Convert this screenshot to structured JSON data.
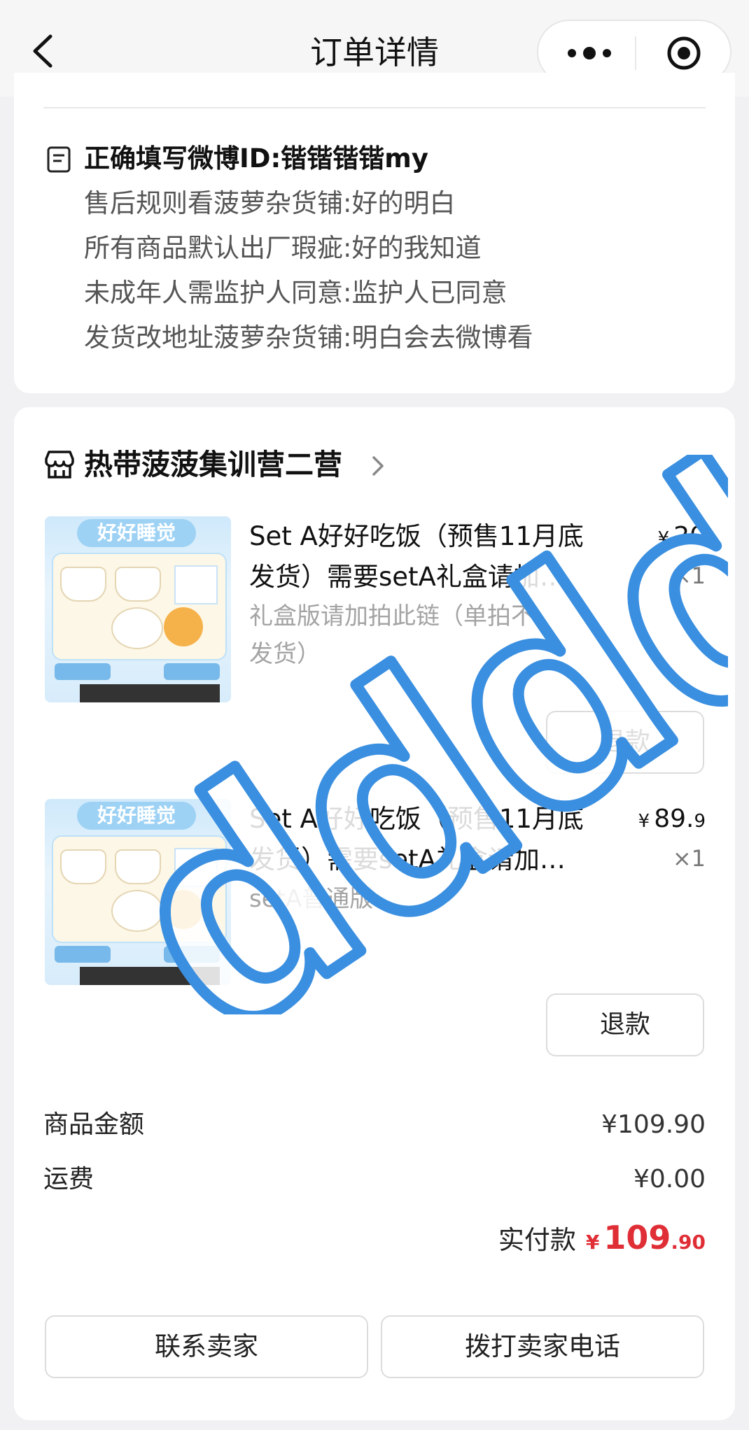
{
  "nav": {
    "title": "订单详情"
  },
  "notes": [
    "正确填写微博ID:锴锴锴锴my",
    "售后规则看菠萝杂货铺:好的明白",
    "所有商品默认出厂瑕疵:好的我知道",
    "未成年人需监护人同意:监护人已同意",
    "发货改地址菠萝杂货铺:明白会去微博看"
  ],
  "shop": {
    "name": "热带菠菠集训营二营"
  },
  "products": [
    {
      "image_banner": "好好睡觉",
      "title_line1": "Set A好好吃饭（预售11月底",
      "title_line2": "发货）需要setA礼盒请加…",
      "spec": "礼盒版请加拍此链（单拍不发货）",
      "price_currency": "¥",
      "price_int": "20",
      "price_dec": "",
      "qty": "×1",
      "refund_label": "退款"
    },
    {
      "image_banner": "好好睡觉",
      "title_line1": "Set A好好吃饭（预售11月底",
      "title_line2": "发货）需要setA礼盒请加…",
      "spec": "setA普通版",
      "price_currency": "¥",
      "price_int": "89.",
      "price_dec": "9",
      "qty": "×1",
      "refund_label": "退款"
    }
  ],
  "summary": {
    "goods_label": "商品金额",
    "goods_value": "¥109.90",
    "shipping_label": "运费",
    "shipping_value": "¥0.00",
    "paid_label": "实付款",
    "paid_currency": "¥",
    "paid_int": "109",
    "paid_dec": ".90"
  },
  "actions": {
    "contact": "联系卖家",
    "call": "拨打卖家电话"
  },
  "watermark": {
    "text": "dddd",
    "color": "#3a8fe0"
  },
  "colors": {
    "price_red": "#e02e36",
    "background": "#f1f1f3"
  }
}
